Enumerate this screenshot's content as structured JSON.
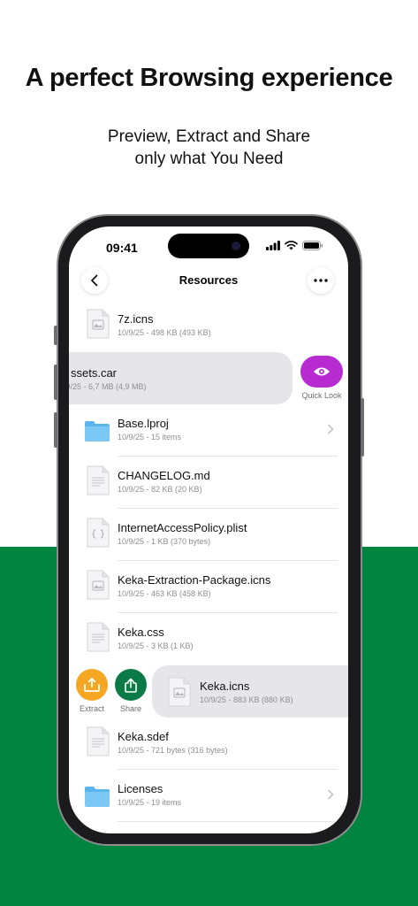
{
  "headline": "A perfect Browsing experience",
  "subline": [
    "Preview, Extract and Share",
    "only what You Need"
  ],
  "colors": {
    "accent_green": "#00843f",
    "quick_look": "#b72bd1",
    "extract": "#f5a623",
    "share": "#0a7a46"
  },
  "status": {
    "time": "09:41"
  },
  "nav": {
    "title": "Resources",
    "back_icon": "chevron-left-icon",
    "more_icon": "ellipsis-icon"
  },
  "files": [
    {
      "name": "7z.icns",
      "meta": "10/9/25 - 498 KB (493 KB)",
      "kind": "image"
    },
    {
      "name": "ssets.car",
      "meta": "/9/25 - 6,7 MB (4,9 MB)",
      "kind": "swipe-left"
    },
    {
      "name": "Base.lproj",
      "meta": "10/9/25 - 15 items",
      "kind": "folder"
    },
    {
      "name": "CHANGELOG.md",
      "meta": "10/9/25 - 82 KB (20 KB)",
      "kind": "text"
    },
    {
      "name": "InternetAccessPolicy.plist",
      "meta": "10/9/25 - 1 KB (370 bytes)",
      "kind": "plist"
    },
    {
      "name": "Keka-Extraction-Package.icns",
      "meta": "10/9/25 - 463 KB (458 KB)",
      "kind": "image"
    },
    {
      "name": "Keka.css",
      "meta": "10/9/25 - 3 KB (1 KB)",
      "kind": "text"
    },
    {
      "name": "Keka.icns",
      "meta": "10/9/25 - 883 KB (880 KB)",
      "kind": "swipe-right"
    },
    {
      "name": "Keka.sdef",
      "meta": "10/9/25 - 721 bytes (316 bytes)",
      "kind": "text"
    },
    {
      "name": "Licenses",
      "meta": "10/9/25 - 19 items",
      "kind": "folder"
    }
  ],
  "actions": {
    "quick_look": "Quick Look",
    "extract": "Extract",
    "share": "Share"
  }
}
